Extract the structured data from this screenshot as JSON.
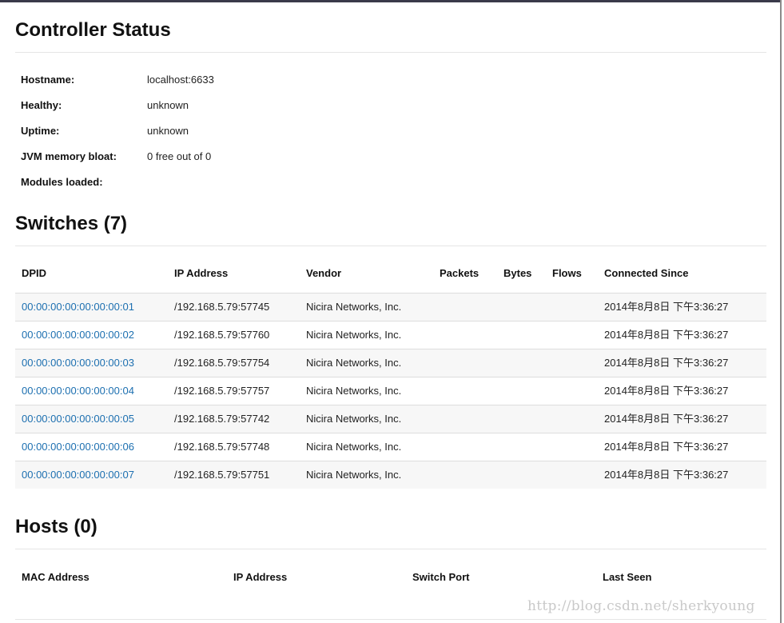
{
  "controller": {
    "title": "Controller Status",
    "rows": [
      {
        "label": "Hostname:",
        "value": "localhost:6633"
      },
      {
        "label": "Healthy:",
        "value": "unknown"
      },
      {
        "label": "Uptime:",
        "value": "unknown"
      },
      {
        "label": "JVM memory bloat:",
        "value": "0 free out of 0"
      },
      {
        "label": "Modules loaded:",
        "value": ""
      }
    ]
  },
  "switches": {
    "title": "Switches (7)",
    "headers": [
      "DPID",
      "IP Address",
      "Vendor",
      "Packets",
      "Bytes",
      "Flows",
      "Connected Since"
    ],
    "rows": [
      {
        "dpid": "00:00:00:00:00:00:00:01",
        "ip": "/192.168.5.79:57745",
        "vendor": "Nicira Networks, Inc.",
        "packets": "",
        "bytes": "",
        "flows": "",
        "since": "2014年8月8日 下午3:36:27"
      },
      {
        "dpid": "00:00:00:00:00:00:00:02",
        "ip": "/192.168.5.79:57760",
        "vendor": "Nicira Networks, Inc.",
        "packets": "",
        "bytes": "",
        "flows": "",
        "since": "2014年8月8日 下午3:36:27"
      },
      {
        "dpid": "00:00:00:00:00:00:00:03",
        "ip": "/192.168.5.79:57754",
        "vendor": "Nicira Networks, Inc.",
        "packets": "",
        "bytes": "",
        "flows": "",
        "since": "2014年8月8日 下午3:36:27"
      },
      {
        "dpid": "00:00:00:00:00:00:00:04",
        "ip": "/192.168.5.79:57757",
        "vendor": "Nicira Networks, Inc.",
        "packets": "",
        "bytes": "",
        "flows": "",
        "since": "2014年8月8日 下午3:36:27"
      },
      {
        "dpid": "00:00:00:00:00:00:00:05",
        "ip": "/192.168.5.79:57742",
        "vendor": "Nicira Networks, Inc.",
        "packets": "",
        "bytes": "",
        "flows": "",
        "since": "2014年8月8日 下午3:36:27"
      },
      {
        "dpid": "00:00:00:00:00:00:00:06",
        "ip": "/192.168.5.79:57748",
        "vendor": "Nicira Networks, Inc.",
        "packets": "",
        "bytes": "",
        "flows": "",
        "since": "2014年8月8日 下午3:36:27"
      },
      {
        "dpid": "00:00:00:00:00:00:00:07",
        "ip": "/192.168.5.79:57751",
        "vendor": "Nicira Networks, Inc.",
        "packets": "",
        "bytes": "",
        "flows": "",
        "since": "2014年8月8日 下午3:36:27"
      }
    ]
  },
  "hosts": {
    "title": "Hosts (0)",
    "headers": [
      "MAC Address",
      "IP Address",
      "Switch Port",
      "Last Seen"
    ]
  },
  "watermark": "http://blog.csdn.net/sherkyoung",
  "colors": {
    "link": "#1c6fb0",
    "stripe": "#f7f7f7",
    "rule": "#e5e5e5"
  }
}
